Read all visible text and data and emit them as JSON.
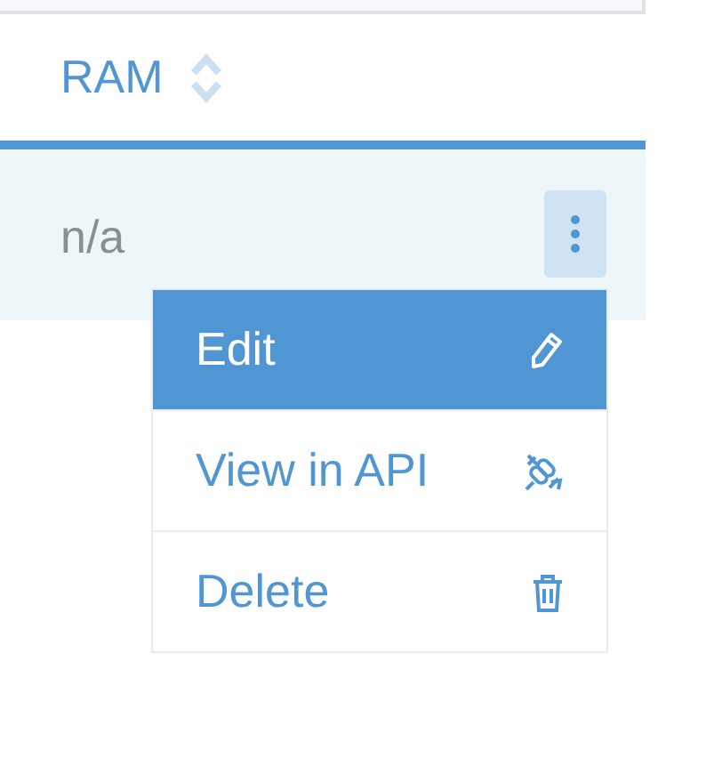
{
  "table": {
    "columns": [
      {
        "label": "RAM"
      }
    ],
    "rows": [
      {
        "cells": [
          "n/a"
        ],
        "menu_open": true
      }
    ]
  },
  "menu": {
    "items": [
      {
        "label": "Edit",
        "selected": true
      },
      {
        "label": "View in API",
        "selected": false
      },
      {
        "label": "Delete",
        "selected": false
      }
    ]
  }
}
